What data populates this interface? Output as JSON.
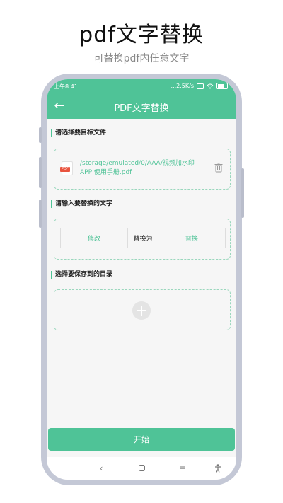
{
  "promo": {
    "title": "pdf文字替换",
    "subtitle": "可替换pdf内任意文字"
  },
  "statusbar": {
    "time": "上午8:41",
    "network": "...2.5K/s",
    "battery": "36"
  },
  "appbar": {
    "title": "PDF文字替换"
  },
  "sections": {
    "select_file": "请选择要目标文件",
    "input_text": "请输入要替换的文字",
    "save_dir": "选择要保存到的目录"
  },
  "file": {
    "path": "/storage/emulated/0/AAA/视频加水印APP 使用手册.pdf",
    "type_tag": "PDF"
  },
  "replace": {
    "from": "修改",
    "connector": "替换为",
    "to": "替换"
  },
  "start_label": "开始",
  "colors": {
    "accent": "#4fc397",
    "file_tag": "#e9543f"
  },
  "icons": {
    "back": "arrow-left-icon",
    "delete": "trash-icon",
    "add": "plus-icon",
    "nav_back": "chevron-left-icon",
    "nav_home": "square-icon",
    "nav_menu": "menu-icon",
    "nav_accessibility": "accessibility-icon"
  }
}
